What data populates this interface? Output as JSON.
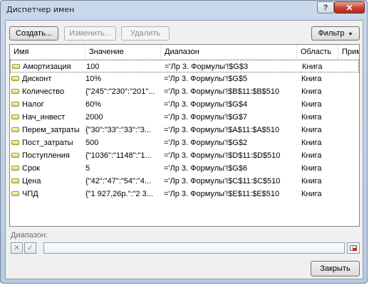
{
  "window": {
    "title": "Диспетчер имен",
    "help": "?",
    "close": "✕"
  },
  "toolbar": {
    "create": "Создать...",
    "change": "Изменить...",
    "delete": "Удалить",
    "filter": "Фильтр",
    "filter_caret": "▼"
  },
  "columns": [
    "Имя",
    "Значение",
    "Диапазон",
    "Область",
    "Прим"
  ],
  "names": [
    {
      "name": "Амортизация",
      "value": "100",
      "ref": "='Лр 3. Формулы'!$G$3",
      "scope": "Книга"
    },
    {
      "name": "Дисконт",
      "value": "10%",
      "ref": "='Лр 3. Формулы'!$G$5",
      "scope": "Книга"
    },
    {
      "name": "Количество",
      "value": "{\"245\":\"230\":\"201\"...",
      "ref": "='Лр 3. Формулы'!$B$11:$B$510",
      "scope": "Книга"
    },
    {
      "name": "Налог",
      "value": "60%",
      "ref": "='Лр 3. Формулы'!$G$4",
      "scope": "Книга"
    },
    {
      "name": "Нач_инвест",
      "value": "2000",
      "ref": "='Лр 3. Формулы'!$G$7",
      "scope": "Книга"
    },
    {
      "name": "Перем_затраты",
      "value": "{\"30\":\"33\":\"33\":\"3...",
      "ref": "='Лр 3. Формулы'!$A$11:$A$510",
      "scope": "Книга"
    },
    {
      "name": "Пост_затраты",
      "value": "500",
      "ref": "='Лр 3. Формулы'!$G$2",
      "scope": "Книга"
    },
    {
      "name": "Поступления",
      "value": "{\"1036\":\"1148\":\"1...",
      "ref": "='Лр 3. Формулы'!$D$11:$D$510",
      "scope": "Книга"
    },
    {
      "name": "Срок",
      "value": "5",
      "ref": "='Лр 3. Формулы'!$G$6",
      "scope": "Книга"
    },
    {
      "name": "Цена",
      "value": "{\"42\":\"47\":\"54\":\"4...",
      "ref": "='Лр 3. Формулы'!$C$11:$C$510",
      "scope": "Книга"
    },
    {
      "name": "ЧПД",
      "value": "{\"1 927,26р.\":\"2 3...",
      "ref": "='Лр 3. Формулы'!$E$11:$E$510",
      "scope": "Книга"
    }
  ],
  "range": {
    "label": "Диапазон:",
    "value": "",
    "cancel": "✕",
    "confirm": "✓"
  },
  "footer": {
    "close": "Закрыть"
  }
}
